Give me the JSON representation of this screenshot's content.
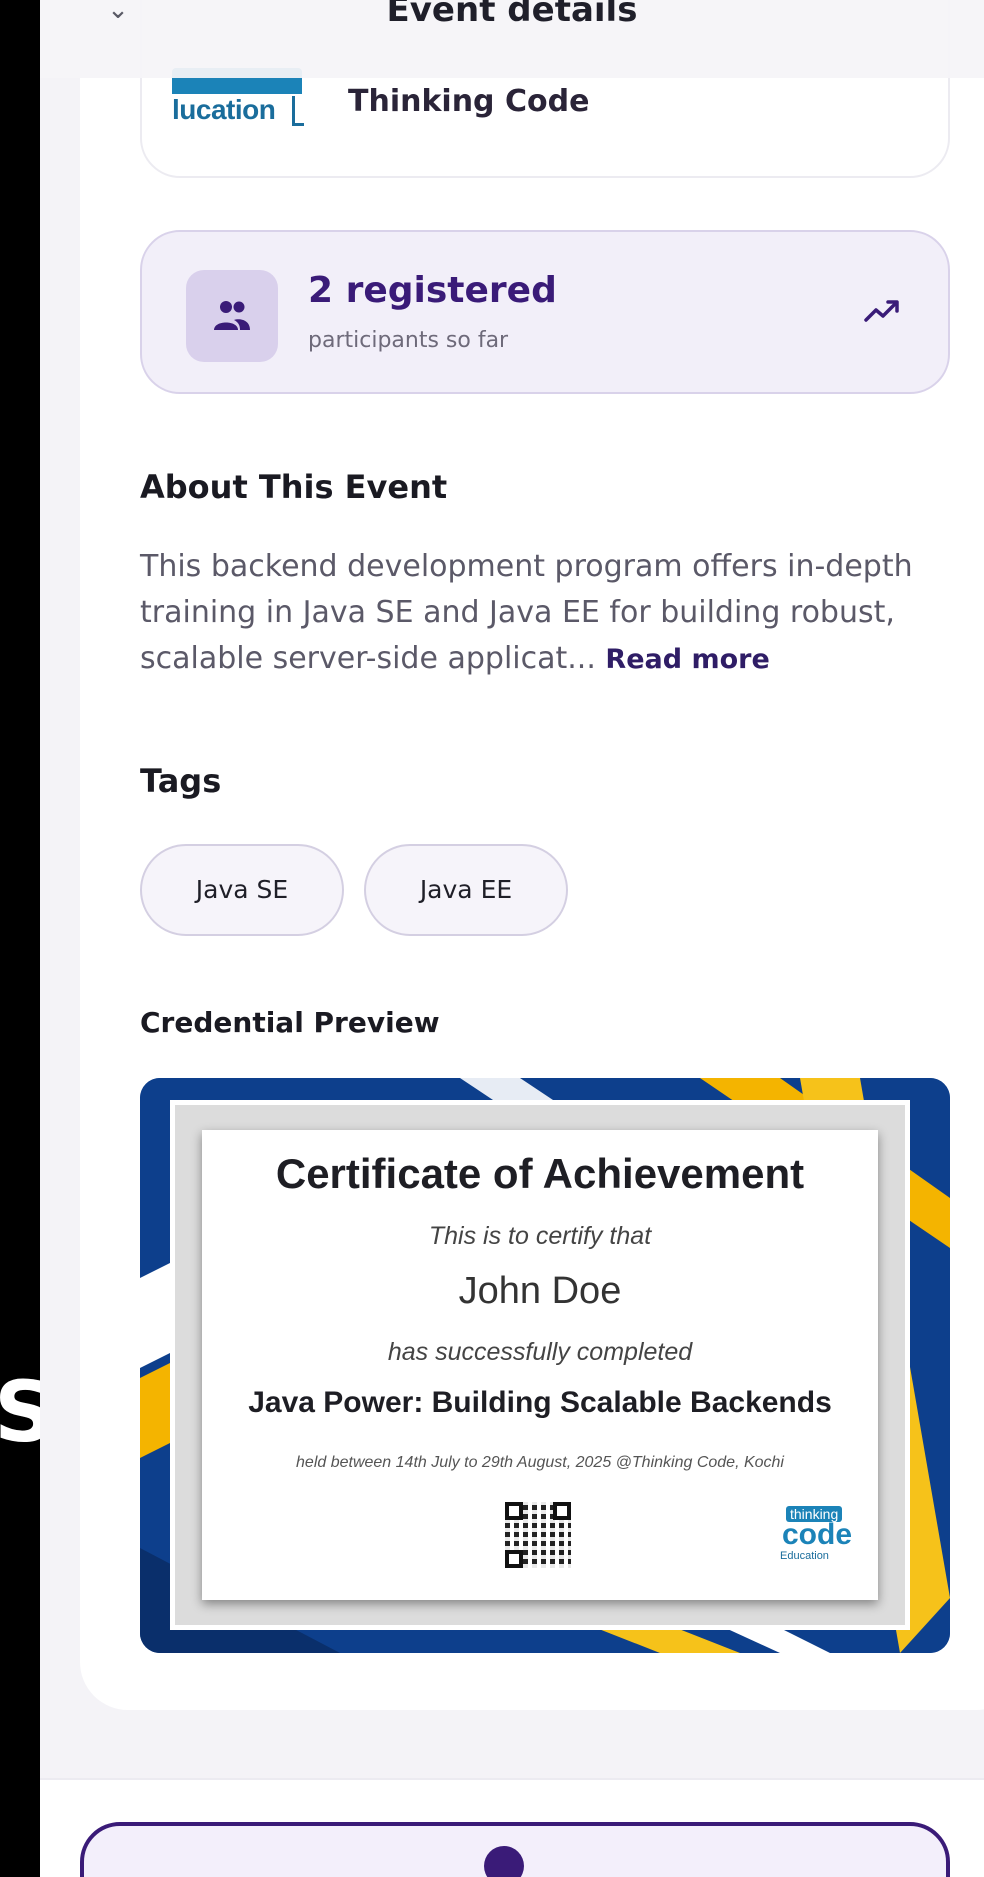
{
  "topbar": {
    "title": "Event details",
    "back_icon": "chevron-down-icon"
  },
  "organizer": {
    "logo_text": "lucation",
    "name": "Thinking Code"
  },
  "registration": {
    "count_label": "2 registered",
    "sub_label": "participants so far",
    "icon": "people-icon",
    "trend_icon": "trending-up-icon",
    "accent": "#3a1b78"
  },
  "about": {
    "heading": "About This Event",
    "body": "This backend development program offers in-depth training in Java SE and Java EE for building robust, scalable server-side applicat... ",
    "read_more": "Read more"
  },
  "tags": {
    "heading": "Tags",
    "items": [
      "Java SE",
      "Java EE"
    ]
  },
  "credential": {
    "heading": "Credential Preview",
    "title": "Certificate of Achievement",
    "line1": "This is to certify that",
    "recipient": "John Doe",
    "line2": "has successfully completed",
    "course": "Java Power: Building Scalable Backends",
    "held": "held between 14th July to 29th August, 2025 @Thinking Code, Kochi",
    "logo_top": "thinking",
    "logo_mid": "code",
    "logo_bottom": "Education"
  },
  "side_glyph": "S",
  "colors": {
    "primary": "#3a1b78",
    "card_bg": "#ffffff",
    "page_bg": "#f4f3f7"
  }
}
